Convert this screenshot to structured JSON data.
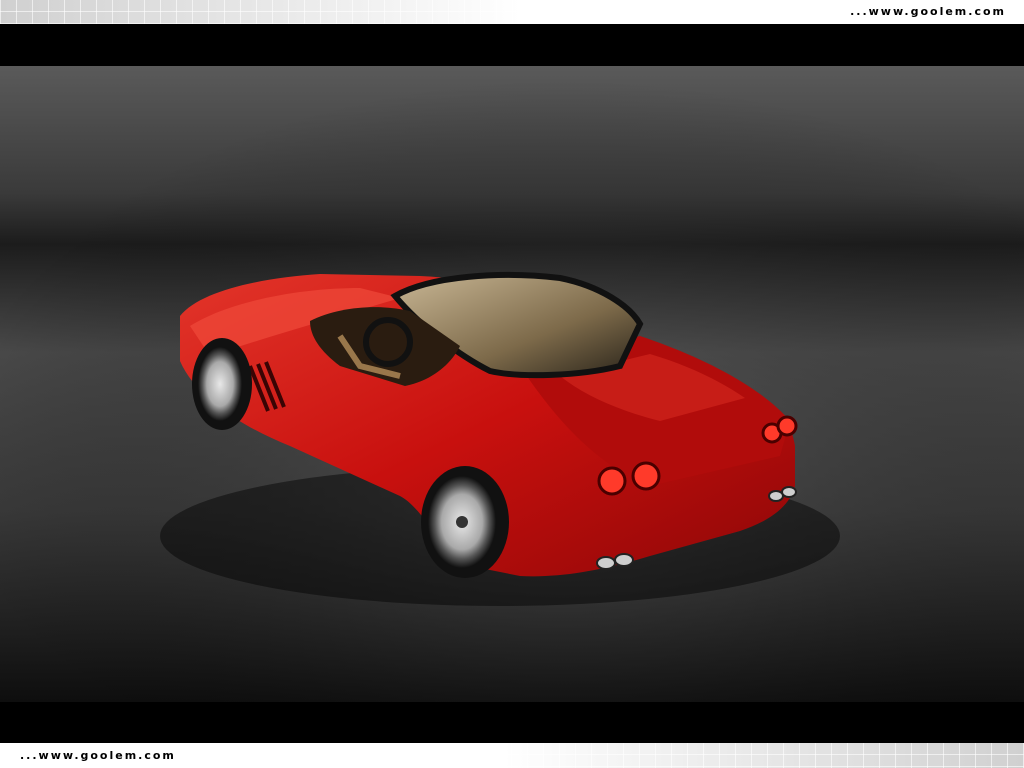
{
  "watermark": {
    "top_text": "...www.goolem.com",
    "bottom_text": "...www.goolem.com"
  },
  "photo": {
    "subject": "red-convertible-sports-car-icon",
    "colors": {
      "car_body": "#c8100e",
      "car_highlight": "#ef4a3a",
      "background_dark": "#1a1a1a",
      "background_light": "#5a5a5a"
    }
  }
}
